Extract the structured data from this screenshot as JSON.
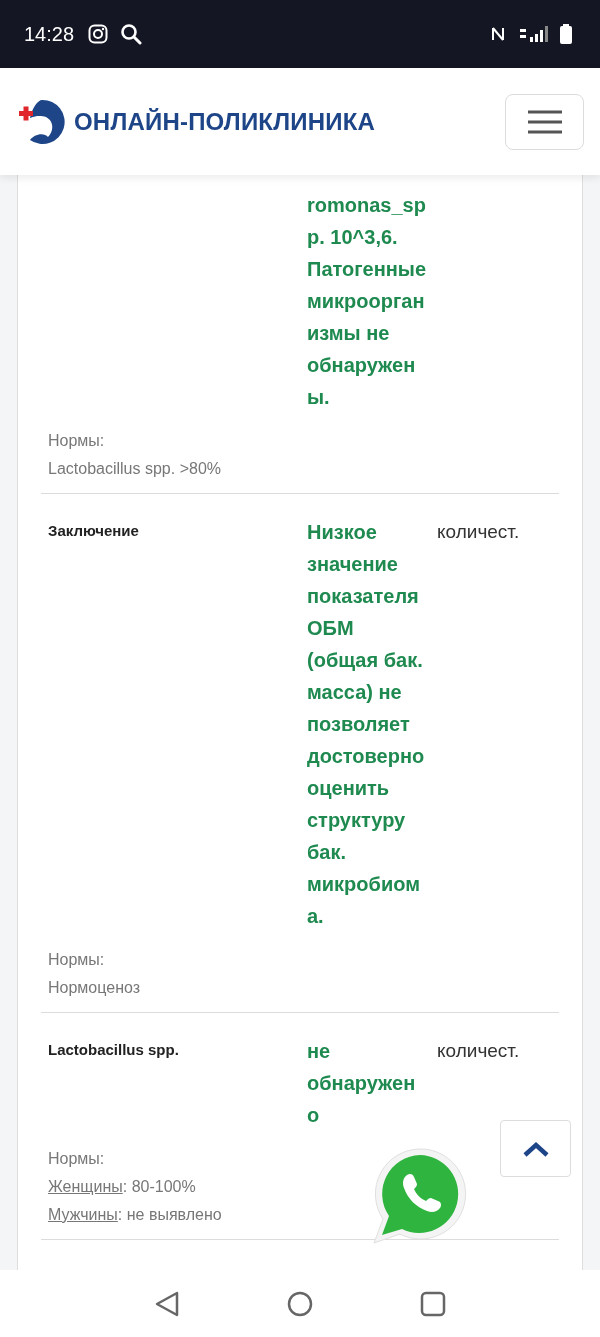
{
  "status_bar": {
    "time": "14:28"
  },
  "header": {
    "logo_text": "ОНЛАЙН-ПОЛИКЛИНИКА"
  },
  "rows": [
    {
      "value": "romonas_spp. 10^3,6. Патогенные микроорганизмы не обнаружены.",
      "norms_label": "Нормы:",
      "norms": [
        {
          "text": "Lactobacillus spp. >80%"
        }
      ]
    },
    {
      "name": "Заключение",
      "value": "Низкое значение показателя ОБМ (общая бак. масса) не позволяет достоверно оценить структуру бак. микробиома.",
      "unit": "количест.",
      "norms_label": "Нормы:",
      "norms": [
        {
          "text": "Нормоценоз"
        }
      ]
    },
    {
      "name": "Lactobacillus spp.",
      "value": "не обнаружено",
      "unit": "количест.",
      "norms_label": "Нормы:",
      "norms": [
        {
          "label": "Женщины",
          "text": ": 80-100%"
        },
        {
          "label": "Мужчины",
          "text": ": не выявлено"
        }
      ]
    }
  ]
}
